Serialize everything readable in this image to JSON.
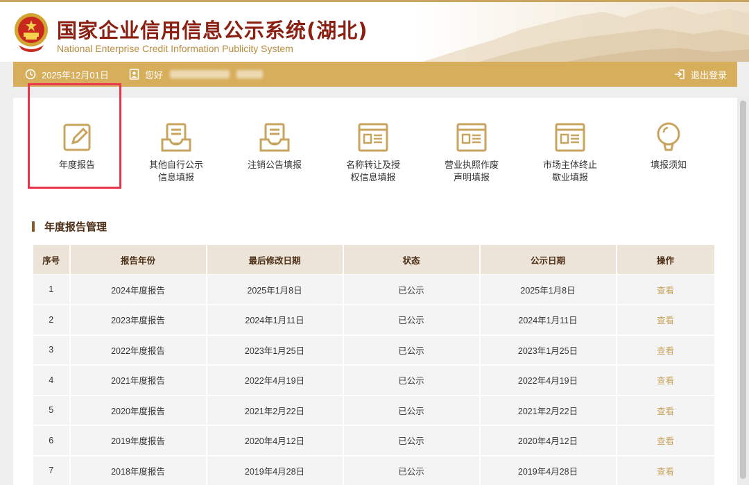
{
  "header": {
    "title_cn": "国家企业信用信息公示系统(湖北)",
    "title_en": "National Enterprise Credit Information Publicity System"
  },
  "infobar": {
    "date": "2025年12月01日",
    "greeting": "您好",
    "logout": "退出登录"
  },
  "nav": [
    {
      "label": "年度报告",
      "icon": "edit-icon"
    },
    {
      "label": "其他自行公示信息填报",
      "icon": "inbox-icon"
    },
    {
      "label": "注销公告填报",
      "icon": "inbox-icon"
    },
    {
      "label": "名称转让及授权信息填报",
      "icon": "browser-window-icon"
    },
    {
      "label": "营业执照作废声明填报",
      "icon": "browser-window-icon"
    },
    {
      "label": "市场主体终止歇业填报",
      "icon": "browser-window-icon"
    },
    {
      "label": "填报须知",
      "icon": "lightbulb-icon"
    }
  ],
  "section_title": "年度报告管理",
  "table": {
    "headers": [
      "序号",
      "报告年份",
      "最后修改日期",
      "状态",
      "公示日期",
      "操作"
    ],
    "rows": [
      [
        "1",
        "2024年度报告",
        "2025年1月8日",
        "已公示",
        "2025年1月8日",
        "查看"
      ],
      [
        "2",
        "2023年度报告",
        "2024年1月11日",
        "已公示",
        "2024年1月11日",
        "查看"
      ],
      [
        "3",
        "2022年度报告",
        "2023年1月25日",
        "已公示",
        "2023年1月25日",
        "查看"
      ],
      [
        "4",
        "2021年度报告",
        "2022年4月19日",
        "已公示",
        "2022年4月19日",
        "查看"
      ],
      [
        "5",
        "2020年度报告",
        "2021年2月22日",
        "已公示",
        "2021年2月22日",
        "查看"
      ],
      [
        "6",
        "2019年度报告",
        "2020年4月12日",
        "已公示",
        "2020年4月12日",
        "查看"
      ],
      [
        "7",
        "2018年度报告",
        "2019年4月28日",
        "已公示",
        "2019年4月28日",
        "查看"
      ]
    ]
  },
  "colors": {
    "accent": "#d7ae5b",
    "title_red": "#8a1f12",
    "highlight_red": "#e8354d",
    "link_gold": "#c9a45f"
  }
}
